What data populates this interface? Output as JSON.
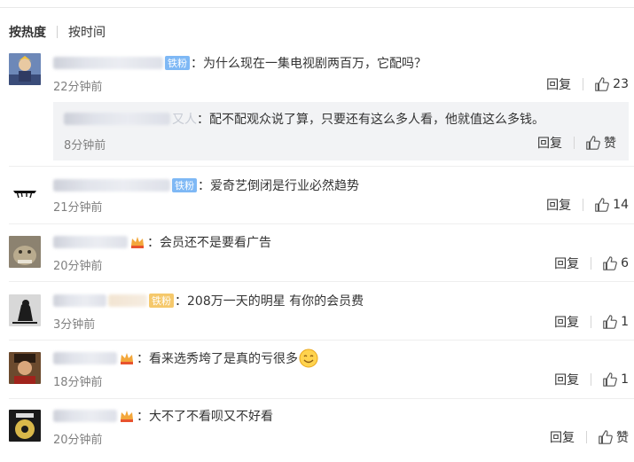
{
  "sort": {
    "hot": "按热度",
    "time": "按时间"
  },
  "comments": [
    {
      "badge": "铁粉",
      "text": "：为什么现在一集电视剧两百万，它配吗？",
      "time": "22分钟前",
      "reply": "回复",
      "likes": "23"
    },
    {
      "badge": "铁粉",
      "text": "：爱奇艺倒闭是行业必然趋势",
      "time": "21分钟前",
      "reply": "回复",
      "likes": "14"
    },
    {
      "text": "：会员还不是要看广告",
      "time": "20分钟前",
      "reply": "回复",
      "likes": "6"
    },
    {
      "badge": "铁粉",
      "text": "：208万一天的明星  有你的会员费",
      "time": "3分钟前",
      "reply": "回复",
      "likes": "1"
    },
    {
      "text": "：看来选秀垮了是真的亏很多",
      "time": "18分钟前",
      "reply": "回复",
      "likes": "1"
    },
    {
      "text": "：大不了不看呗又不好看",
      "time": "20分钟前",
      "reply": "回复",
      "likes": "赞"
    }
  ],
  "subreply": {
    "name_tail": "又人",
    "text": "：配不配观众说了算，只要还有这么多人看，他就值这么多钱。",
    "time": "8分钟前",
    "reply": "回复",
    "likes": "赞"
  },
  "icons": {
    "like": "thumbs-up-icon",
    "crown": "crown-icon",
    "emoji": "smile-emoji-icon"
  },
  "colors": {
    "fan_badge": "#7eb8f5",
    "time": "#808080",
    "subreply_bg": "#f2f3f5"
  }
}
